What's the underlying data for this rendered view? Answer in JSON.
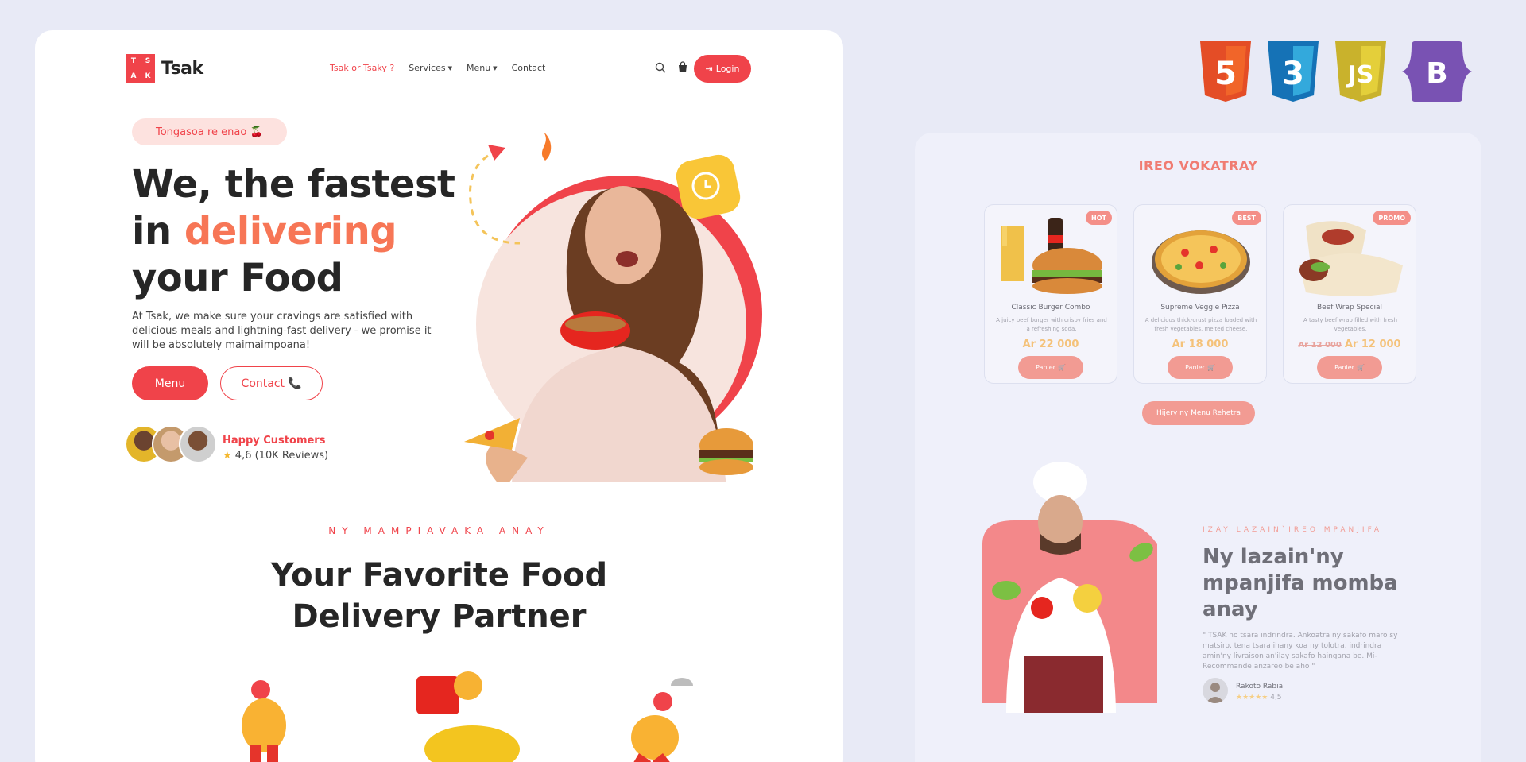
{
  "brand": {
    "logo_letters": [
      "T",
      "S",
      "A",
      "K"
    ],
    "name": "Tsak",
    "accent_color": "#f0434a"
  },
  "nav": {
    "links": [
      {
        "label": "Tsak or Tsaky ?",
        "active": true
      },
      {
        "label": "Services",
        "dropdown": true
      },
      {
        "label": "Menu",
        "dropdown": true
      },
      {
        "label": "Contact"
      }
    ],
    "login_label": "Login",
    "icons": [
      "search-icon",
      "cart-icon",
      "login-icon"
    ]
  },
  "hero": {
    "pill": "Tongasoa re enao 🍒",
    "headline_line1": "We, the fastest",
    "headline_in": "in ",
    "headline_accent": "delivering",
    "headline_line3": "your Food",
    "lead": "At Tsak, we make sure your cravings are satisfied with delicious meals and lightning-fast delivery - we promise it will be absolutely maimaimpoana!",
    "menu_button": "Menu",
    "contact_button": "Contact",
    "customers_title": "Happy Customers",
    "customers_rating": "4,6 (10K Reviews)"
  },
  "section": {
    "eyebrow": "NY MAMPIAVAKA ANAY",
    "title_line1": "Your Favorite Food",
    "title_line2": "Delivery Partner"
  },
  "tech_logos": [
    "html5-icon",
    "css3-icon",
    "javascript-icon",
    "bootstrap-icon"
  ],
  "tech_labels": {
    "html5": "5",
    "css3": "3",
    "js": "JS",
    "bootstrap": "B"
  },
  "showcase": {
    "title": "IREO VOKATRAY",
    "cards": [
      {
        "badge": "HOT",
        "name": "Classic Burger Combo",
        "desc": "A juicy beef burger with crispy fries and a refreshing soda.",
        "old_price": "",
        "price": "Ar 22 000",
        "button": "Panier"
      },
      {
        "badge": "BEST",
        "name": "Supreme Veggie Pizza",
        "desc": "A delicious thick-crust pizza loaded with fresh vegetables, melted cheese.",
        "old_price": "",
        "price": "Ar 18 000",
        "button": "Panier"
      },
      {
        "badge": "PROMO",
        "name": "Beef Wrap Special",
        "desc": "A tasty beef wrap filled with fresh vegetables.",
        "old_price": "Ar 12 000",
        "price": "Ar 12 000",
        "button": "Panier"
      }
    ],
    "see_menu": "Hijery ny Menu Rehetra",
    "eyebrow": "IZAY LAZAIN`IREO MPANJIFA",
    "heading": "Ny lazain'ny mpanjifa momba anay",
    "quote": "\" TSAK no tsara indrindra. Ankoatra ny sakafo maro sy matsiro, tena tsara ihany koa ny tolotra, indrindra amin'ny livraison an'ilay sakafo haingana be. Mi-Recommande anzareo be aho \"",
    "author": "Rakoto Rabia",
    "author_rating": "4,5",
    "author_stars": "★★★★★"
  }
}
